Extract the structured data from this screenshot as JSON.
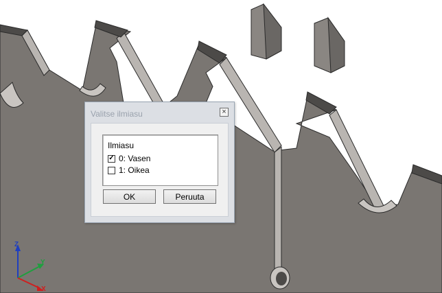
{
  "dialog": {
    "title": "Valitse ilmiasu",
    "close_glyph": "×",
    "group_label": "Ilmiasu",
    "options": [
      {
        "label": "0: Vasen",
        "checked": true
      },
      {
        "label": "1: Oikea",
        "checked": false
      }
    ],
    "ok_label": "OK",
    "cancel_label": "Peruuta"
  },
  "triad": {
    "z_label": "Z",
    "y_label": "Y",
    "x_label": "X",
    "z_color": "#1f3fbf",
    "y_color": "#1f9f3f",
    "x_color": "#cf1f1f"
  },
  "scene": {
    "background": "#ffffff",
    "face_color": "#7a7672",
    "edge_color": "#b9b5b1",
    "line_color": "#2a2a2a",
    "insert_color": "#8a8682"
  }
}
